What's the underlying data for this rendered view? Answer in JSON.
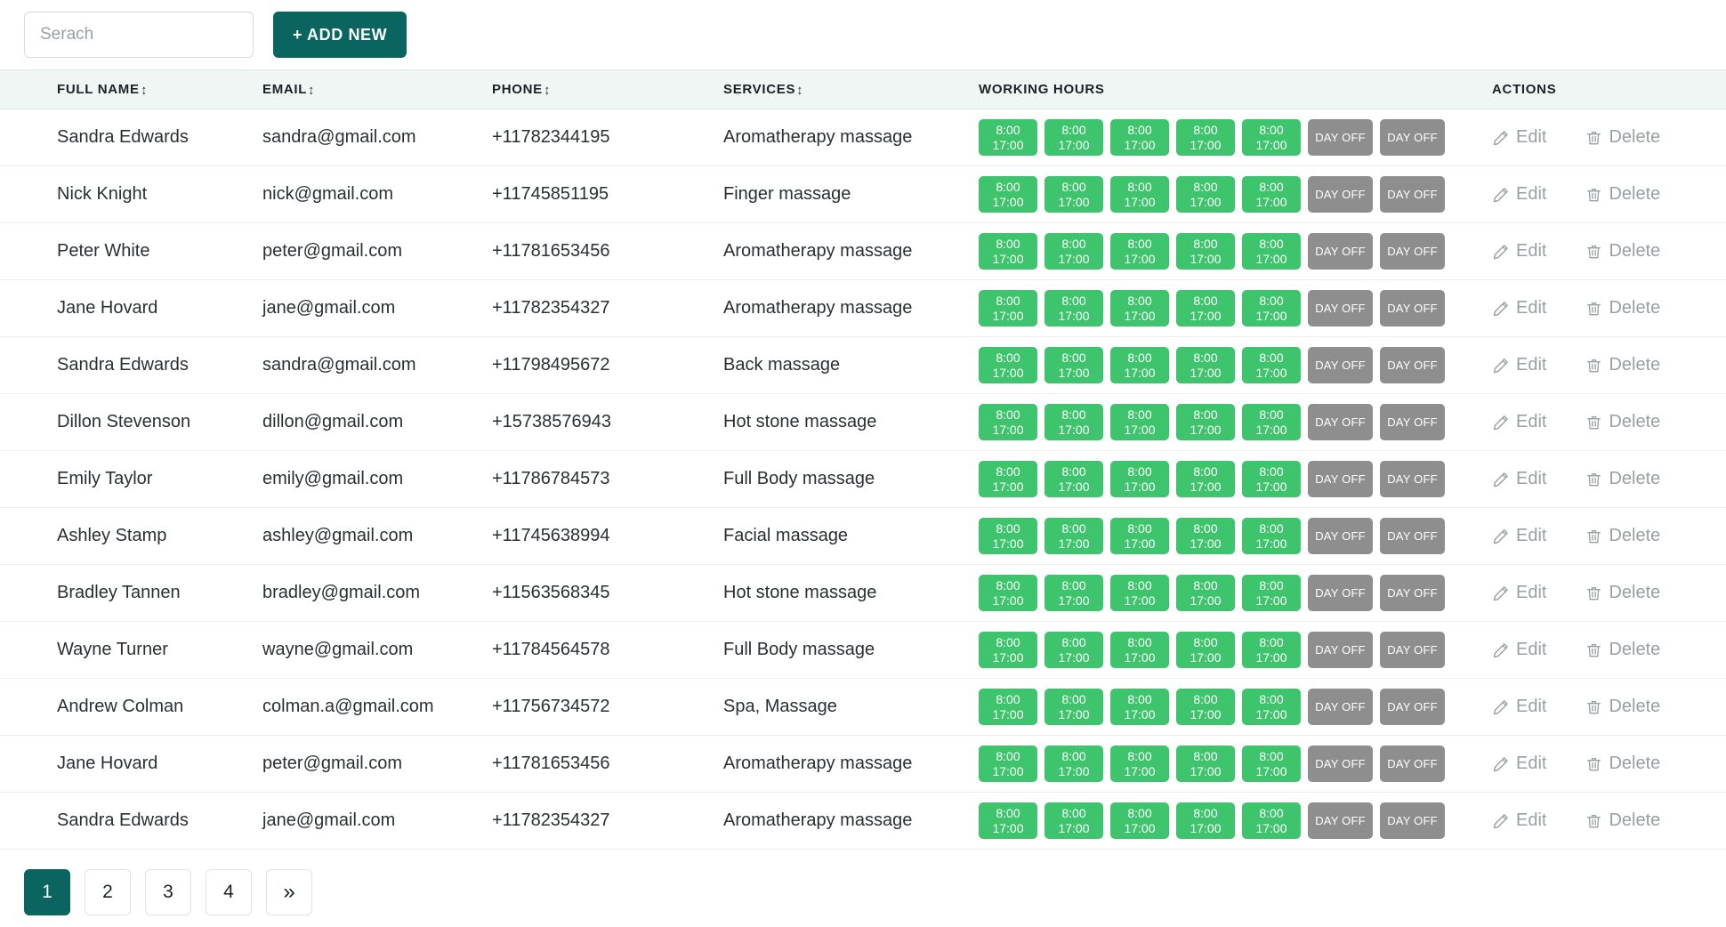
{
  "toolbar": {
    "search_placeholder": "Serach",
    "search_value": "",
    "add_new_label": "+ ADD NEW"
  },
  "table": {
    "columns": [
      {
        "key": "full_name",
        "label": "FULL NAME",
        "sortable": true,
        "sort_icon": "sort-arrow-icon"
      },
      {
        "key": "email",
        "label": "EMAIL",
        "sortable": true,
        "sort_icon": "sort-arrow-icon"
      },
      {
        "key": "phone",
        "label": "PHONE",
        "sortable": true,
        "sort_icon": "sort-arrow-icon"
      },
      {
        "key": "services",
        "label": "SERVICES",
        "sortable": true,
        "sort_icon": "sort-arrow-icon"
      },
      {
        "key": "hours",
        "label": "WORKING HOURS",
        "sortable": false
      },
      {
        "key": "actions",
        "label": "ACTIONS",
        "sortable": false
      }
    ],
    "sort_glyph": "↕",
    "working_hours_pattern": {
      "work_days": 5,
      "off_days": 2,
      "start_time": "8:00",
      "end_time": "17:00",
      "day_off_label": "DAY OFF"
    },
    "actions": {
      "edit_label": "Edit",
      "edit_icon": "pencil-icon",
      "delete_label": "Delete",
      "delete_icon": "trash-icon"
    },
    "rows": [
      {
        "full_name": "Sandra Edwards",
        "email": "sandra@gmail.com",
        "phone": "+11782344195",
        "services": "Aromatherapy massage"
      },
      {
        "full_name": "Nick Knight",
        "email": "nick@gmail.com",
        "phone": "+11745851195",
        "services": "Finger massage"
      },
      {
        "full_name": "Peter White",
        "email": "peter@gmail.com",
        "phone": "+11781653456",
        "services": "Aromatherapy massage"
      },
      {
        "full_name": "Jane Hovard",
        "email": "jane@gmail.com",
        "phone": "+11782354327",
        "services": "Aromatherapy massage"
      },
      {
        "full_name": "Sandra Edwards",
        "email": "sandra@gmail.com",
        "phone": "+11798495672",
        "services": "Back massage"
      },
      {
        "full_name": "Dillon Stevenson",
        "email": "dillon@gmail.com",
        "phone": "+15738576943",
        "services": "Hot stone massage"
      },
      {
        "full_name": "Emily Taylor",
        "email": "emily@gmail.com",
        "phone": "+11786784573",
        "services": "Full Body massage"
      },
      {
        "full_name": "Ashley Stamp",
        "email": "ashley@gmail.com",
        "phone": "+11745638994",
        "services": "Facial massage"
      },
      {
        "full_name": "Bradley Tannen",
        "email": "bradley@gmail.com",
        "phone": "+11563568345",
        "services": "Hot stone massage"
      },
      {
        "full_name": "Wayne Turner",
        "email": "wayne@gmail.com",
        "phone": "+11784564578",
        "services": "Full Body massage"
      },
      {
        "full_name": "Andrew Colman",
        "email": "colman.a@gmail.com",
        "phone": "+11756734572",
        "services": "Spa, Massage"
      },
      {
        "full_name": "Jane Hovard",
        "email": "peter@gmail.com",
        "phone": "+11781653456",
        "services": "Aromatherapy massage"
      },
      {
        "full_name": "Sandra Edwards",
        "email": "jane@gmail.com",
        "phone": "+11782354327",
        "services": "Aromatherapy massage"
      }
    ]
  },
  "pagination": {
    "pages": [
      "1",
      "2",
      "3",
      "4"
    ],
    "active_page": "1",
    "next_label": "»",
    "next_icon": "chevron-double-right-icon"
  },
  "colors": {
    "accent": "#0a6460",
    "header_bg": "#eff6f4",
    "badge_work": "#3ec46d",
    "badge_off": "#8e8e8e",
    "muted_text": "#9a9fa3"
  }
}
